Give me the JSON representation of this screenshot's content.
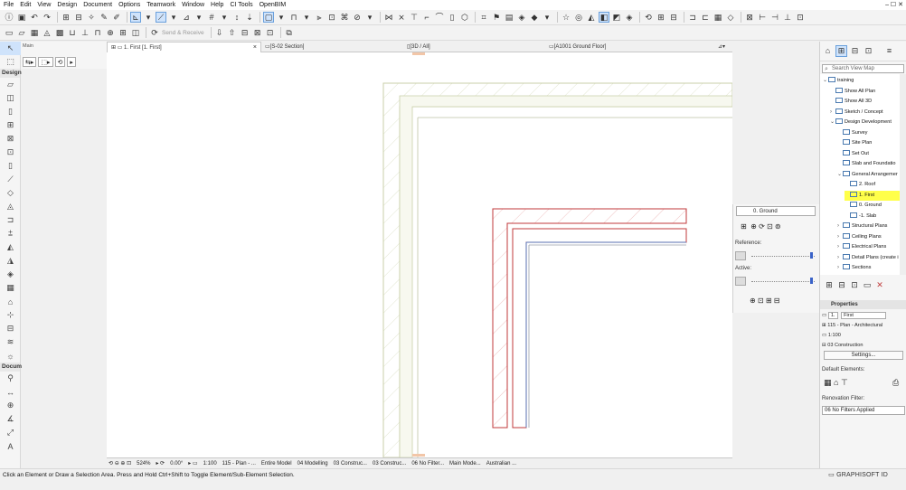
{
  "menu": [
    "File",
    "Edit",
    "View",
    "Design",
    "Document",
    "Options",
    "Teamwork",
    "Window",
    "Help",
    "CI Tools",
    "OpenBIM"
  ],
  "window_controls": "–  ☐  ✕",
  "toolbar2": {
    "send_receive": "Send & Receive"
  },
  "infobox": {
    "label": "Main"
  },
  "toolbox": {
    "design_label": "Design",
    "document_label": "Docum"
  },
  "tabs": [
    {
      "label": "1. First [1. First]",
      "close": "×"
    },
    {
      "label": "[S-02 Section]"
    },
    {
      "label": "[3D / All]"
    },
    {
      "label": "[A1001 Ground Floor]"
    }
  ],
  "quick_options": {
    "zoom": "524%",
    "angle": "0.00°",
    "scale": "1:100",
    "layer_combo": "115 - Plan - ...",
    "model_view": "Entire Model",
    "structure": "04 Modelling",
    "pen_set": "03 Construc...",
    "mvo": "03 Construc...",
    "renovation": "06 No Filter...",
    "dimension": "Main Mode...",
    "unit": "Australian ..."
  },
  "status": {
    "message": "Click an Element or Draw a Selection Area. Press and Hold Ctrl+Shift to Toggle Element/Sub-Element Selection.",
    "brand": "GRAPHISOFT ID"
  },
  "layers_palette": {
    "story": "0. Ground",
    "reference_label": "Reference:",
    "active_label": "Active:",
    "reference_level": 0.95,
    "active_level": 0.95
  },
  "navigator": {
    "search_placeholder": "Search View Map",
    "tree": [
      {
        "label": "training",
        "depth": 0,
        "arrow": "⌄"
      },
      {
        "label": "Show All Plan",
        "depth": 1,
        "arrow": ""
      },
      {
        "label": "Show All 3D",
        "depth": 1,
        "arrow": ""
      },
      {
        "label": "Sketch / Concept",
        "depth": 1,
        "arrow": "›"
      },
      {
        "label": "Design Development",
        "depth": 1,
        "arrow": "⌄"
      },
      {
        "label": "Survey",
        "depth": 2,
        "arrow": ""
      },
      {
        "label": "Site Plan",
        "depth": 2,
        "arrow": ""
      },
      {
        "label": "Set Out",
        "depth": 2,
        "arrow": ""
      },
      {
        "label": "Slab and Foundatio",
        "depth": 2,
        "arrow": ""
      },
      {
        "label": "General Arrangemer",
        "depth": 2,
        "arrow": "⌄"
      },
      {
        "label": "2. Roof",
        "depth": 3,
        "arrow": ""
      },
      {
        "label": "1. First",
        "depth": 3,
        "arrow": "",
        "highlight": true
      },
      {
        "label": "0. Ground",
        "depth": 3,
        "arrow": ""
      },
      {
        "label": "-1. Slab",
        "depth": 3,
        "arrow": ""
      },
      {
        "label": "Structural Plans",
        "depth": 2,
        "arrow": "›"
      },
      {
        "label": "Ceiling Plans",
        "depth": 2,
        "arrow": "›"
      },
      {
        "label": "Electrical Plans",
        "depth": 2,
        "arrow": "›"
      },
      {
        "label": "Detail Plans (create i",
        "depth": 2,
        "arrow": "›"
      },
      {
        "label": "Sections",
        "depth": 2,
        "arrow": "›"
      }
    ],
    "properties_title": "Properties",
    "prop_id": "1.",
    "prop_name": "First",
    "prop_layer": "115 - Plan - Architectural",
    "prop_scale": "1:100",
    "prop_structure": "03 Construction",
    "settings_button": "Settings...",
    "default_elements_label": "Default Elements:",
    "renovation_label": "Renovation Filter:",
    "renovation_value": "06 No Filters Applied"
  },
  "colors": {
    "selected_bg": "#cfe3fb",
    "highlight": "#ffff4a",
    "wall_red": "#c0393b",
    "wall_green": "#d8dcc4",
    "accent_blue": "#3a62c8"
  }
}
